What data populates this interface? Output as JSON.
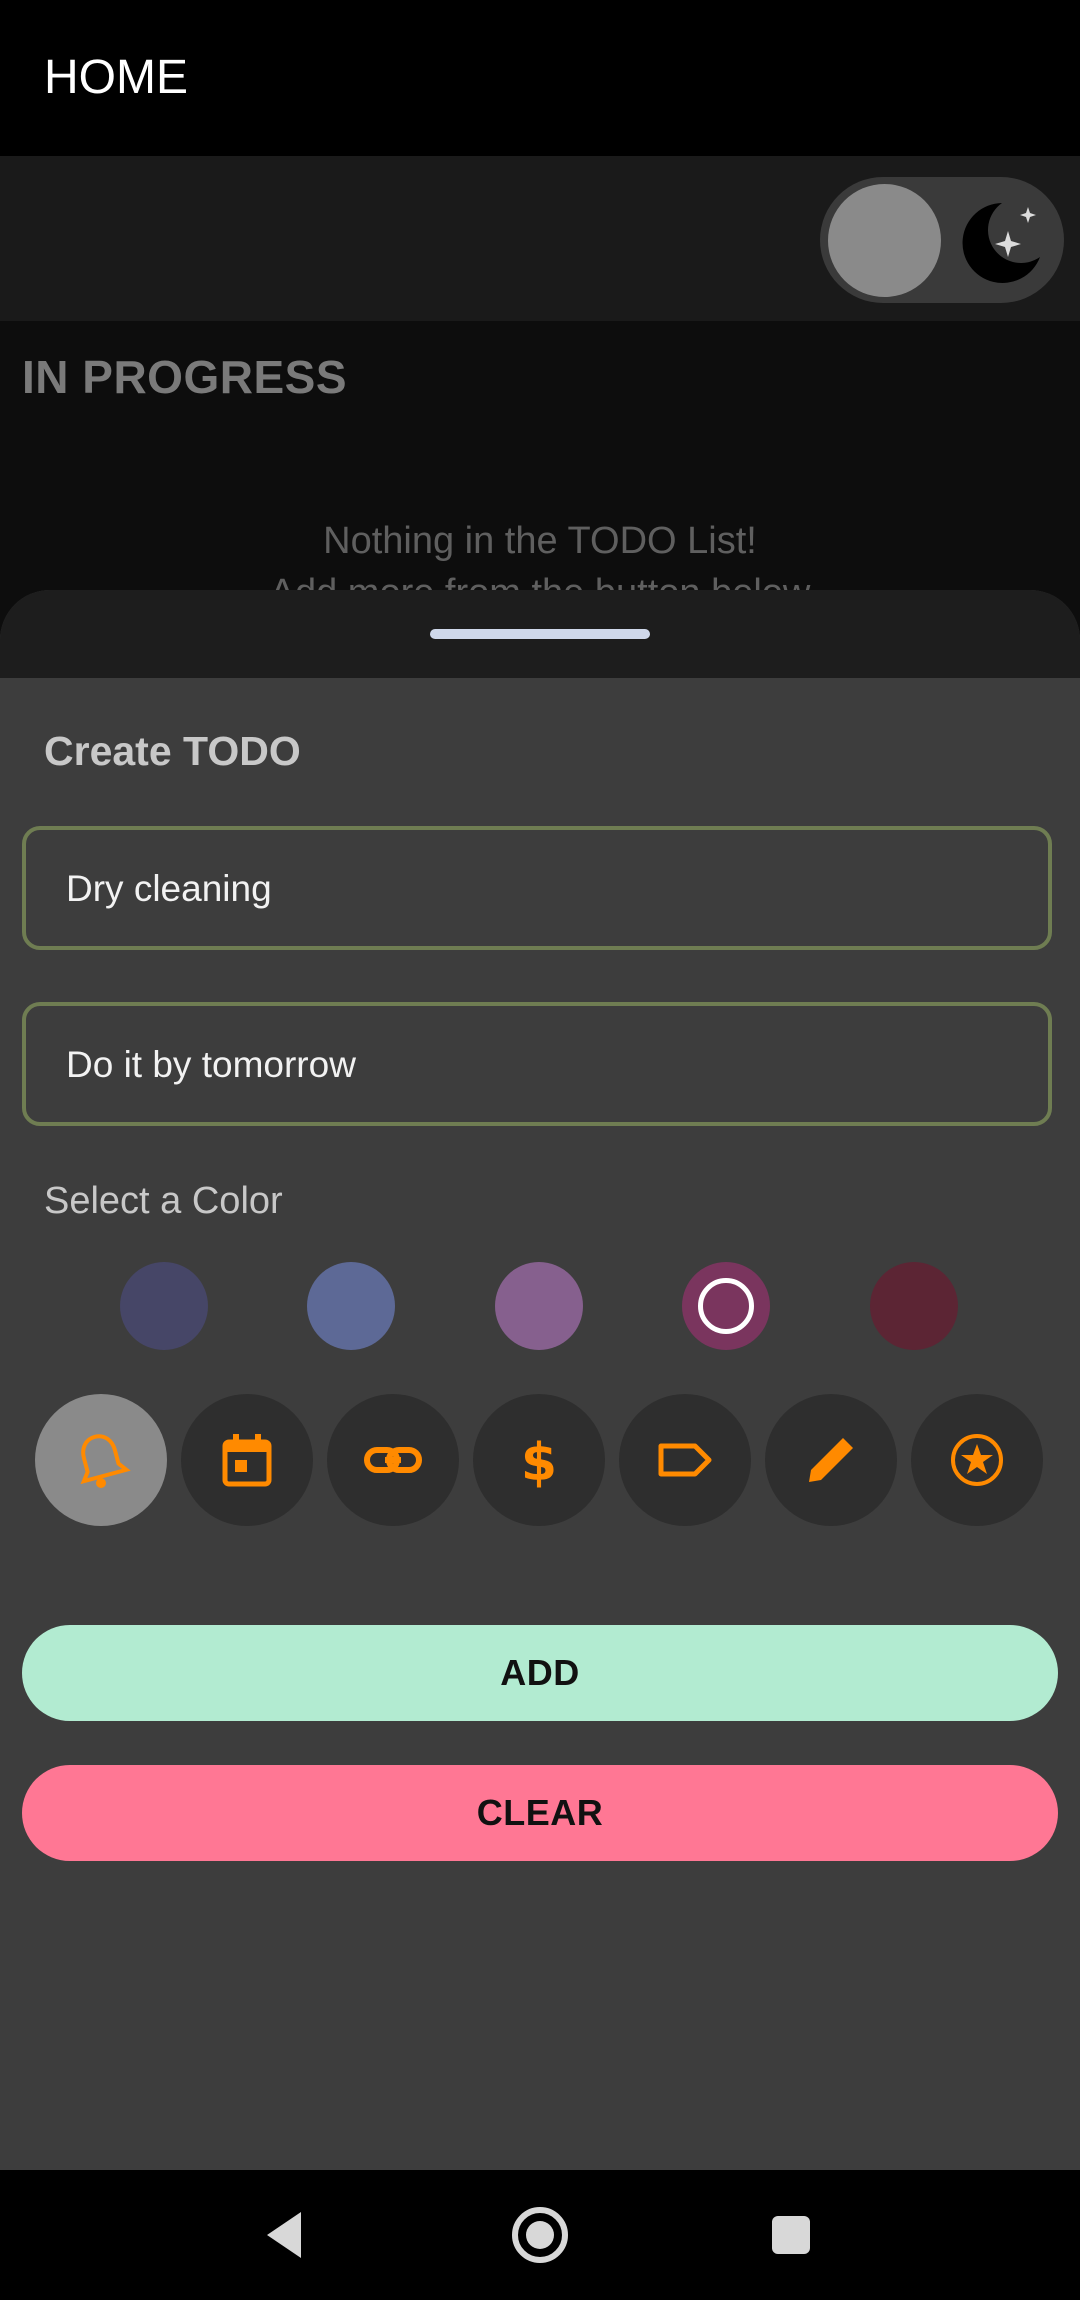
{
  "appbar": {
    "title": "HOME"
  },
  "toolbar": {
    "theme_toggle_state": "dark"
  },
  "section": {
    "title": "IN PROGRESS",
    "empty_line_1": "Nothing in the TODO List!",
    "empty_line_2": "Add more from the button below"
  },
  "sheet": {
    "title": "Create TODO",
    "title_field_value": "Dry cleaning",
    "description_field_value": "Do it by tomorrow",
    "color_label": "Select a Color",
    "colors": [
      "#464667",
      "#5d6996",
      "#86608e",
      "#7a355e",
      "#5c2534"
    ],
    "selected_color_index": 3,
    "icons": [
      "bell-icon",
      "calendar-icon",
      "link-icon",
      "dollar-icon",
      "tag-icon",
      "pencil-icon",
      "star-icon"
    ],
    "selected_icon_index": 0,
    "add_label": "ADD",
    "clear_label": "CLEAR"
  },
  "accent_color": "#ff8a00"
}
